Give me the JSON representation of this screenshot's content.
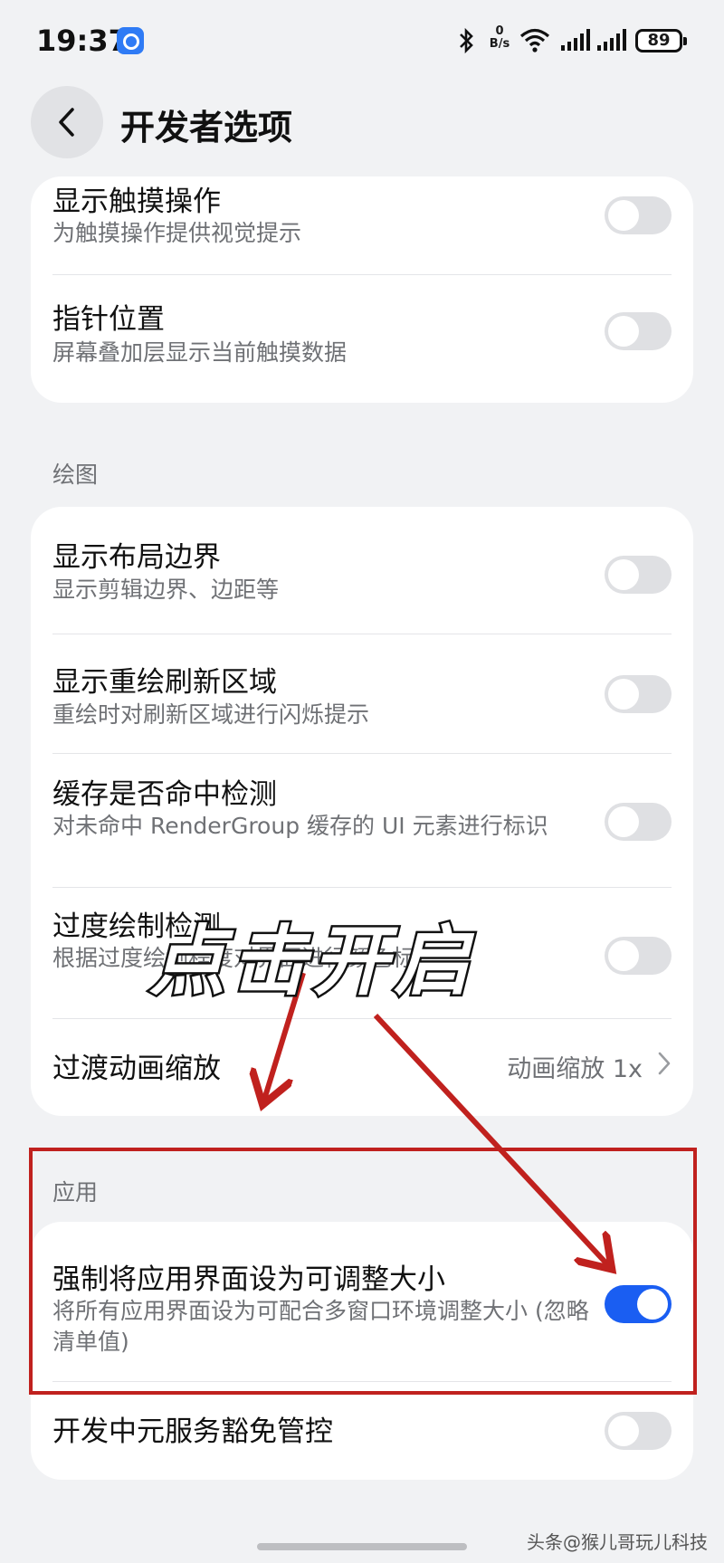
{
  "status_bar": {
    "time": "19:37",
    "speed_value": "0",
    "speed_unit": "B/s",
    "battery": "89"
  },
  "header": {
    "title": "开发者选项"
  },
  "card_top": {
    "rows": [
      {
        "title": "显示触摸操作",
        "subtitle": "为触摸操作提供视觉提示",
        "enabled": false
      },
      {
        "title": "指针位置",
        "subtitle": "屏幕叠加层显示当前触摸数据",
        "enabled": false
      }
    ]
  },
  "drawing_section": {
    "label": "绘图",
    "rows": [
      {
        "title": "显示布局边界",
        "subtitle": "显示剪辑边界、边距等",
        "enabled": false
      },
      {
        "title": "显示重绘刷新区域",
        "subtitle": "重绘时对刷新区域进行闪烁提示",
        "enabled": false
      },
      {
        "title": "缓存是否命中检测",
        "subtitle": "对未命中 RenderGroup 缓存的 UI 元素进行标识",
        "enabled": false
      },
      {
        "title": "过度绘制检测",
        "subtitle": "根据过度绘制程度对界面进行颜色标识",
        "enabled": false
      }
    ],
    "animation_row": {
      "title": "过渡动画缩放",
      "value": "动画缩放 1x"
    }
  },
  "apps_section": {
    "label": "应用",
    "rows": [
      {
        "title": "强制将应用界面设为可调整大小",
        "subtitle": "将所有应用界面设为可配合多窗口环境调整大小 (忽略清单值)",
        "enabled": true
      },
      {
        "title": "开发中元服务豁免管控",
        "enabled": false
      }
    ]
  },
  "annotation": {
    "text": "点击开启",
    "color": "#c0211e"
  },
  "watermark": "头条@猴儿哥玩儿科技",
  "colors": {
    "accent": "#1a5ef2",
    "background": "#f1f2f4"
  }
}
